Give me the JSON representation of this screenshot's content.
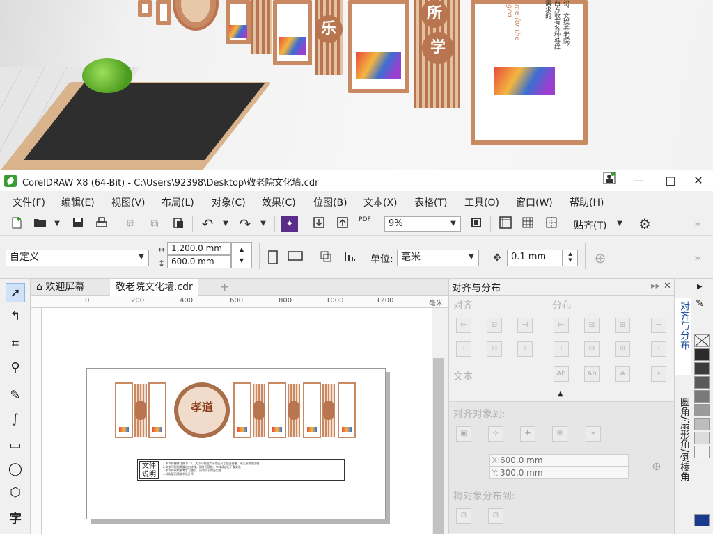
{
  "window": {
    "title": "CorelDRAW X8 (64-Bit) - C:\\Users\\92398\\Desktop\\敬老院文化墙.cdr",
    "controls": {
      "minimize": "—",
      "maximize": "□",
      "close": "✕"
    }
  },
  "render": {
    "medallion_chars": [
      "乐",
      "所",
      "学"
    ],
    "side_caption": "ome for the aged",
    "side_text": "识，文娱养老院，西方收有各种各样需求的"
  },
  "menubar": [
    "文件(F)",
    "编辑(E)",
    "视图(V)",
    "布局(L)",
    "对象(C)",
    "效果(C)",
    "位图(B)",
    "文本(X)",
    "表格(T)",
    "工具(O)",
    "窗口(W)",
    "帮助(H)"
  ],
  "toolbar1": {
    "zoom_value": "9%",
    "snap_label": "贴齐(T)",
    "pdf_label": "PDF"
  },
  "toolbar2": {
    "page_preset": "自定义",
    "page_width": "1,200.0 mm",
    "page_height": "600.0 mm",
    "units_label": "单位:",
    "units_value": "毫米",
    "nudge_value": "0.1 mm"
  },
  "document_tabs": [
    "欢迎屏幕",
    "敬老院文化墙.cdr"
  ],
  "ruler": {
    "ticks": [
      "0",
      "200",
      "400",
      "600",
      "800",
      "1000",
      "1200"
    ],
    "unit": "毫米"
  },
  "canvas": {
    "medallion_text": "孝道",
    "note_label": "文件说明",
    "note_lines": [
      "1.本文件整体比例为1:1，大小可根据实际墙面尺寸自由调整，请注意排版比例",
      "2.文字可根据需要自由修改，图片可替换，字体请自行下载安装",
      "3.本文件仅供参考学习使用，请勿用于商业用途",
      "4.如有疑问请联系设计师"
    ]
  },
  "docker": {
    "title": "对齐与分布",
    "section_align": "对齐",
    "section_distribute": "分布",
    "section_text": "文本",
    "align_to_label": "对齐对象到:",
    "distribute_to_label": "将对象分布到:",
    "x_value": "600.0 mm",
    "y_value": "300.0 mm"
  },
  "side_tabs": [
    "对齐与分布",
    "圆角/扇形角/倒棱角"
  ],
  "palette": {
    "colors": [
      "#ffffff",
      "#2b2b2b",
      "#3c3c3c",
      "#5a5a5a",
      "#7a7a7a",
      "#9a9a9a",
      "#bdbdbd",
      "#dcdcdc",
      "#f2f2f2",
      "#1a3a8f"
    ]
  },
  "colors": {
    "wood": "#c98a63",
    "accent_blue": "#1a4f9c",
    "corel_green": "#3a9c35"
  }
}
